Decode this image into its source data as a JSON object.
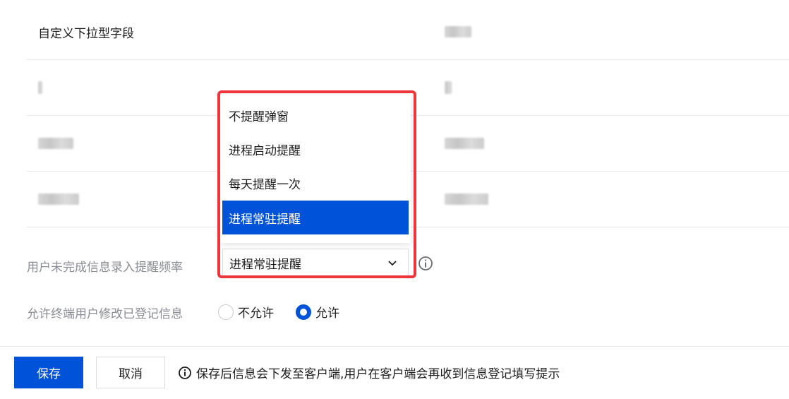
{
  "table": {
    "rows": [
      {
        "label": "自定义下拉型字段"
      },
      {
        "label": ""
      },
      {
        "label": ""
      },
      {
        "label": ""
      }
    ]
  },
  "form": {
    "reminder_label": "用户未完成信息录入提醒频率",
    "reminder_value": "进程常驻提醒",
    "allow_edit_label": "允许终端用户修改已登记信息",
    "radio_no": "不允许",
    "radio_yes": "允许",
    "radio_selected": "允许"
  },
  "dropdown": {
    "options": [
      "不提醒弹窗",
      "进程启动提醒",
      "每天提醒一次",
      "进程常驻提醒"
    ],
    "selected": "进程常驻提醒"
  },
  "footer": {
    "save_label": "保存",
    "cancel_label": "取消",
    "tip_text": "保存后信息会下发至客户端,用户在客户端会再收到信息登记填写提示"
  },
  "colors": {
    "primary": "#0052d9",
    "highlight": "#f0343c"
  },
  "icons": [
    "chevron-down-icon",
    "info-icon",
    "info-circle-icon"
  ]
}
